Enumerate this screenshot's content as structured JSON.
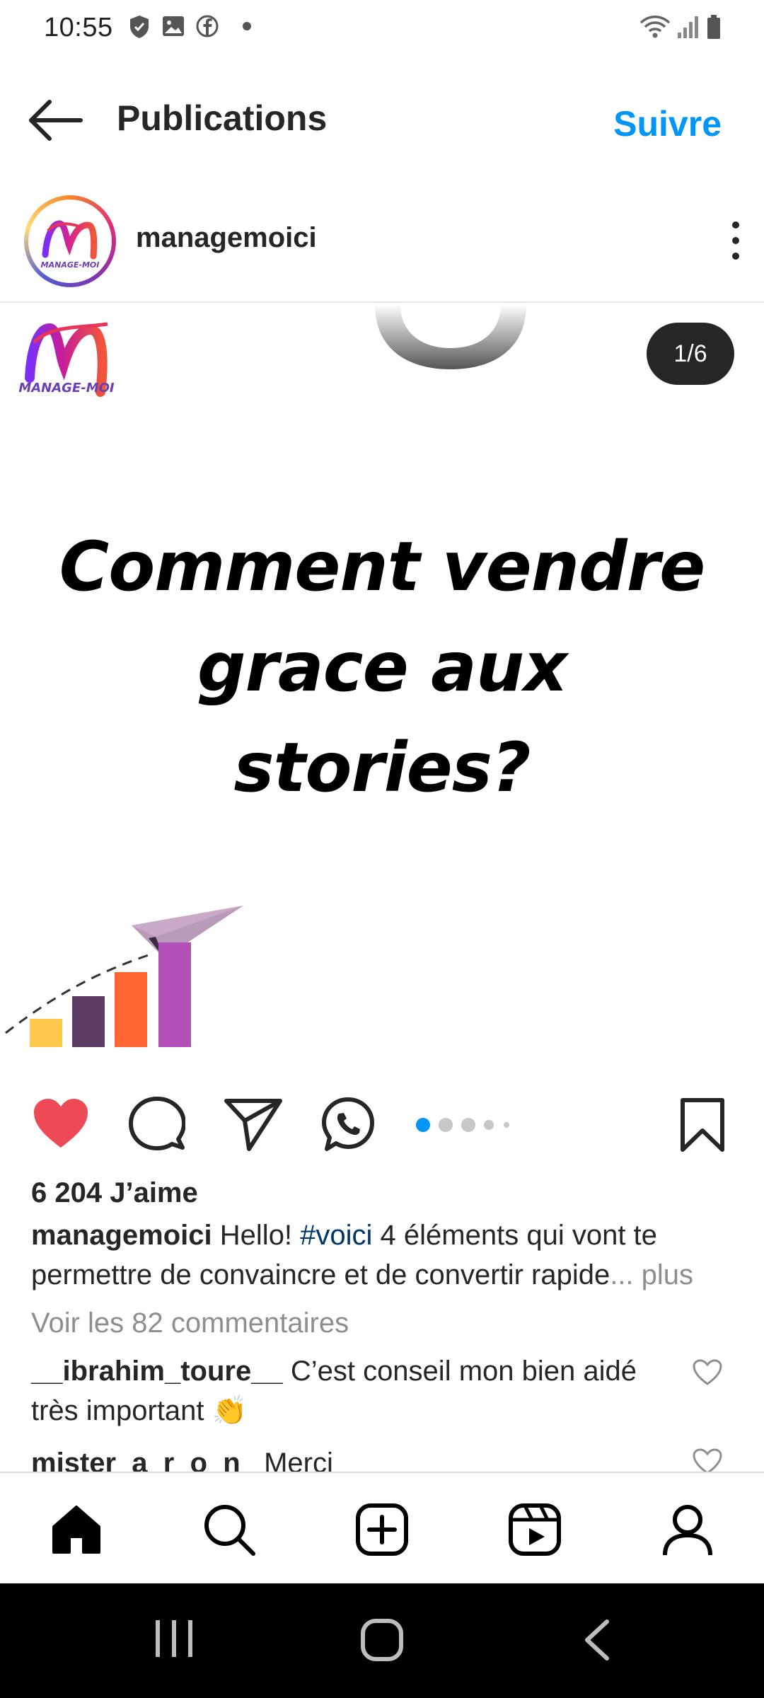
{
  "status_bar": {
    "time": "10:55",
    "icons": [
      "shield-icon",
      "image-icon",
      "facebook-icon",
      "dot-icon",
      "wifi-icon",
      "signal-icon",
      "battery-icon"
    ]
  },
  "top_bar": {
    "title": "Publications",
    "follow_label": "Suivre",
    "accent_color": "#0095f6"
  },
  "post": {
    "username": "managemoici",
    "avatar_text": "MANAGE-MOI",
    "image": {
      "counter": "1/6",
      "logo_text": "MANAGE-MOI",
      "headline_lines": [
        "Comment vendre",
        "grace aux",
        "stories?"
      ]
    },
    "carousel": {
      "count": 6,
      "current": 1
    },
    "likes": "6 204 J’aime",
    "caption": {
      "username": "managemoici",
      "text_before_tag": "Hello! ",
      "hashtag": "#voici",
      "text_after_tag": " 4 éléments qui vont te permettre de convaincre et de convertir rapide",
      "more": "... plus"
    },
    "view_comments": "Voir les 82 commentaires",
    "comments": [
      {
        "username": "__ibrahim_toure__",
        "text": " C’est conseil mon bien aidé très important 👏"
      },
      {
        "username": "mister_a_r_o_n_",
        "text": " Merci"
      }
    ]
  },
  "bottom_nav": [
    "home-icon",
    "search-icon",
    "create-icon",
    "reels-icon",
    "profile-icon"
  ],
  "system_nav": [
    "recent-apps-icon",
    "home-button-icon",
    "back-icon"
  ]
}
